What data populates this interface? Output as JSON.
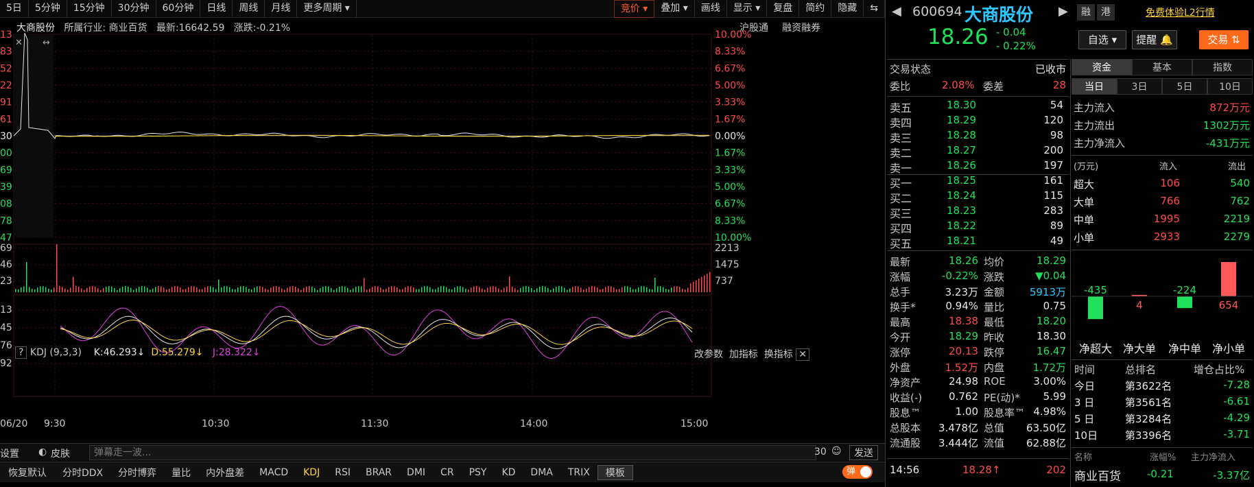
{
  "toolbar": {
    "periods": [
      "5日",
      "5分钟",
      "15分钟",
      "30分钟",
      "60分钟",
      "日线",
      "周线",
      "月线",
      "更多周期"
    ],
    "right": [
      "竞价",
      "叠加",
      "画线",
      "显示",
      "复盘",
      "简约",
      "隐藏"
    ]
  },
  "info_bar": {
    "name": "大商股份",
    "industry": "所属行业: 商业百货",
    "latest": "最新:16642.59",
    "change": "涨跌:-0.21%",
    "links": [
      "沪股通",
      "融资融券"
    ]
  },
  "chart_data": {
    "type": "line",
    "right_axis_labels": [
      "10.00%",
      "8.33%",
      "6.67%",
      "5.00%",
      "3.33%",
      "1.67%",
      "0.00%",
      "1.67%",
      "3.33%",
      "5.00%",
      "6.67%",
      "8.33%",
      "10.00%"
    ],
    "left_axis_labels": [
      "13",
      "83",
      "52",
      "22",
      "91",
      "61",
      "30",
      "00",
      "69",
      "39",
      "08",
      "78",
      "47"
    ],
    "x_labels": [
      "06/20",
      "9:30",
      "10:30",
      "11:30",
      "14:00",
      "15:00"
    ],
    "volume_axis_right": [
      "2213",
      "1475",
      "737"
    ],
    "volume_axis_left": [
      "69",
      "46",
      "23"
    ],
    "kdj_axis_left": [
      "13",
      "45",
      "76",
      "92"
    ]
  },
  "kdj": {
    "label": "KDJ (9,3,3)",
    "k": "K:46.293↓",
    "d": "D:55.279↓",
    "j": "J:28.322↓",
    "actions": [
      "改参数",
      "加指标",
      "换指标"
    ]
  },
  "bottom": {
    "settings": "设置",
    "skin": "皮肤",
    "comment_placeholder": "弹幕走一波...",
    "count": "30",
    "send": "发送",
    "tabs": [
      "恢复默认",
      "分时DDX",
      "分时博弈",
      "量比",
      "内外盘差",
      "MACD",
      "KDJ",
      "RSI",
      "BRAR",
      "DMI",
      "CR",
      "PSY",
      "KD",
      "DMA",
      "TRIX",
      "模板"
    ],
    "toggle": "弹"
  },
  "quote": {
    "code": "600694",
    "name": "大商股份",
    "tag1": "融",
    "tag2": "港",
    "l2": "免费体验L2行情",
    "price": "18.26",
    "change": "- 0.04",
    "pct": "- 0.22%",
    "watch": "自选",
    "alert": "提醒",
    "trade": "交易",
    "status_label": "交易状态",
    "status": "已收市",
    "wb_label": "委比",
    "wb": "2.08%",
    "wc_label": "委差",
    "wc": "28"
  },
  "book": [
    [
      "卖五",
      "18.30",
      "54"
    ],
    [
      "卖四",
      "18.29",
      "120"
    ],
    [
      "卖三",
      "18.28",
      "98"
    ],
    [
      "卖二",
      "18.27",
      "200"
    ],
    [
      "卖一",
      "18.26",
      "197"
    ],
    [
      "买一",
      "18.25",
      "161"
    ],
    [
      "买二",
      "18.24",
      "115"
    ],
    [
      "买三",
      "18.23",
      "283"
    ],
    [
      "买四",
      "18.22",
      "89"
    ],
    [
      "买五",
      "18.21",
      "49"
    ]
  ],
  "stats": [
    [
      "最新",
      "18.26",
      "均价",
      "18.29"
    ],
    [
      "涨幅",
      "-0.22%",
      "涨跌",
      "▼0.04"
    ],
    [
      "总手",
      "3.23万",
      "金额",
      "5913万"
    ],
    [
      "换手*",
      "0.94%",
      "量比",
      "0.75"
    ],
    [
      "最高",
      "18.38",
      "最低",
      "18.20"
    ],
    [
      "今开",
      "18.29",
      "昨收",
      "18.30"
    ],
    [
      "涨停",
      "20.13",
      "跌停",
      "16.47"
    ],
    [
      "外盘",
      "1.52万",
      "内盘",
      "1.72万"
    ],
    [
      "净资产",
      "24.98",
      "ROE",
      "3.00%"
    ],
    [
      "收益(-)",
      "0.762",
      "PE(动)*",
      "5.99"
    ],
    [
      "股息™",
      "1.00",
      "股息率™",
      "4.98%"
    ],
    [
      "总股本",
      "3.478亿",
      "总值",
      "63.50亿"
    ],
    [
      "流通股",
      "3.444亿",
      "流值",
      "62.88亿"
    ]
  ],
  "tick": {
    "time": "14:56",
    "price": "18.28↑",
    "vol": "202"
  },
  "funds": {
    "tabs": [
      "资金",
      "基本",
      "指数"
    ],
    "periods": [
      "当日",
      "3日",
      "5日",
      "10日"
    ],
    "flow": [
      [
        "主力流入",
        "872万元"
      ],
      [
        "主力流出",
        "1302万元"
      ],
      [
        "主力净流入",
        "-431万元"
      ]
    ],
    "table_head": [
      "(万元)",
      "流入",
      "流出"
    ],
    "table": [
      [
        "超大",
        "106",
        "540"
      ],
      [
        "大单",
        "766",
        "762"
      ],
      [
        "中单",
        "1995",
        "2219"
      ],
      [
        "小单",
        "2933",
        "2279"
      ]
    ],
    "bars": [
      {
        "label": "净超大",
        "value": -435
      },
      {
        "label": "净大单",
        "value": 4
      },
      {
        "label": "净中单",
        "value": -224
      },
      {
        "label": "净小单",
        "value": 654
      }
    ],
    "rank_head": [
      "时间",
      "总排名",
      "增仓占比%"
    ],
    "rank": [
      [
        "今日",
        "第3622名",
        "-7.28"
      ],
      [
        "3 日",
        "第3561名",
        "-6.61"
      ],
      [
        "5 日",
        "第3284名",
        "-4.29"
      ],
      [
        "10日",
        "第3396名",
        "-3.71"
      ]
    ],
    "sector_head": [
      "名称",
      "涨幅%",
      "主力净流入"
    ],
    "sector": [
      "商业百货",
      "-0.21",
      "-3.37亿"
    ]
  }
}
